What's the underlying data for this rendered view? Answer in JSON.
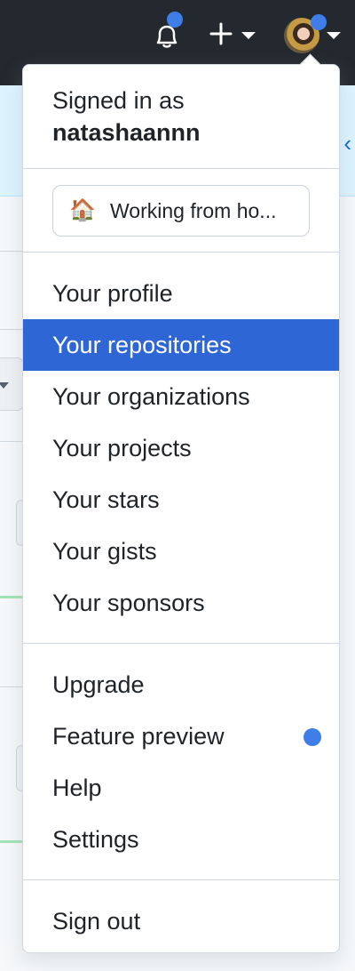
{
  "header": {
    "icons": [
      "bell-icon",
      "plus-icon",
      "avatar"
    ],
    "notification_dot_color": "#3f7ee8",
    "background": "#24292f"
  },
  "menu": {
    "signed_in_prefix": "Signed in as",
    "username": "natashaannn",
    "status": {
      "emoji": "🏠",
      "text": "Working from ho..."
    },
    "items_group1": [
      {
        "label": "Your profile",
        "active": false
      },
      {
        "label": "Your repositories",
        "active": true
      },
      {
        "label": "Your organizations",
        "active": false
      },
      {
        "label": "Your projects",
        "active": false
      },
      {
        "label": "Your stars",
        "active": false
      },
      {
        "label": "Your gists",
        "active": false
      },
      {
        "label": "Your sponsors",
        "active": false
      }
    ],
    "items_group2": [
      {
        "label": "Upgrade"
      },
      {
        "label": "Feature preview"
      },
      {
        "label": "Help"
      },
      {
        "label": "Settings"
      }
    ],
    "sign_out": "Sign out",
    "active_color": "#2f66d6"
  }
}
